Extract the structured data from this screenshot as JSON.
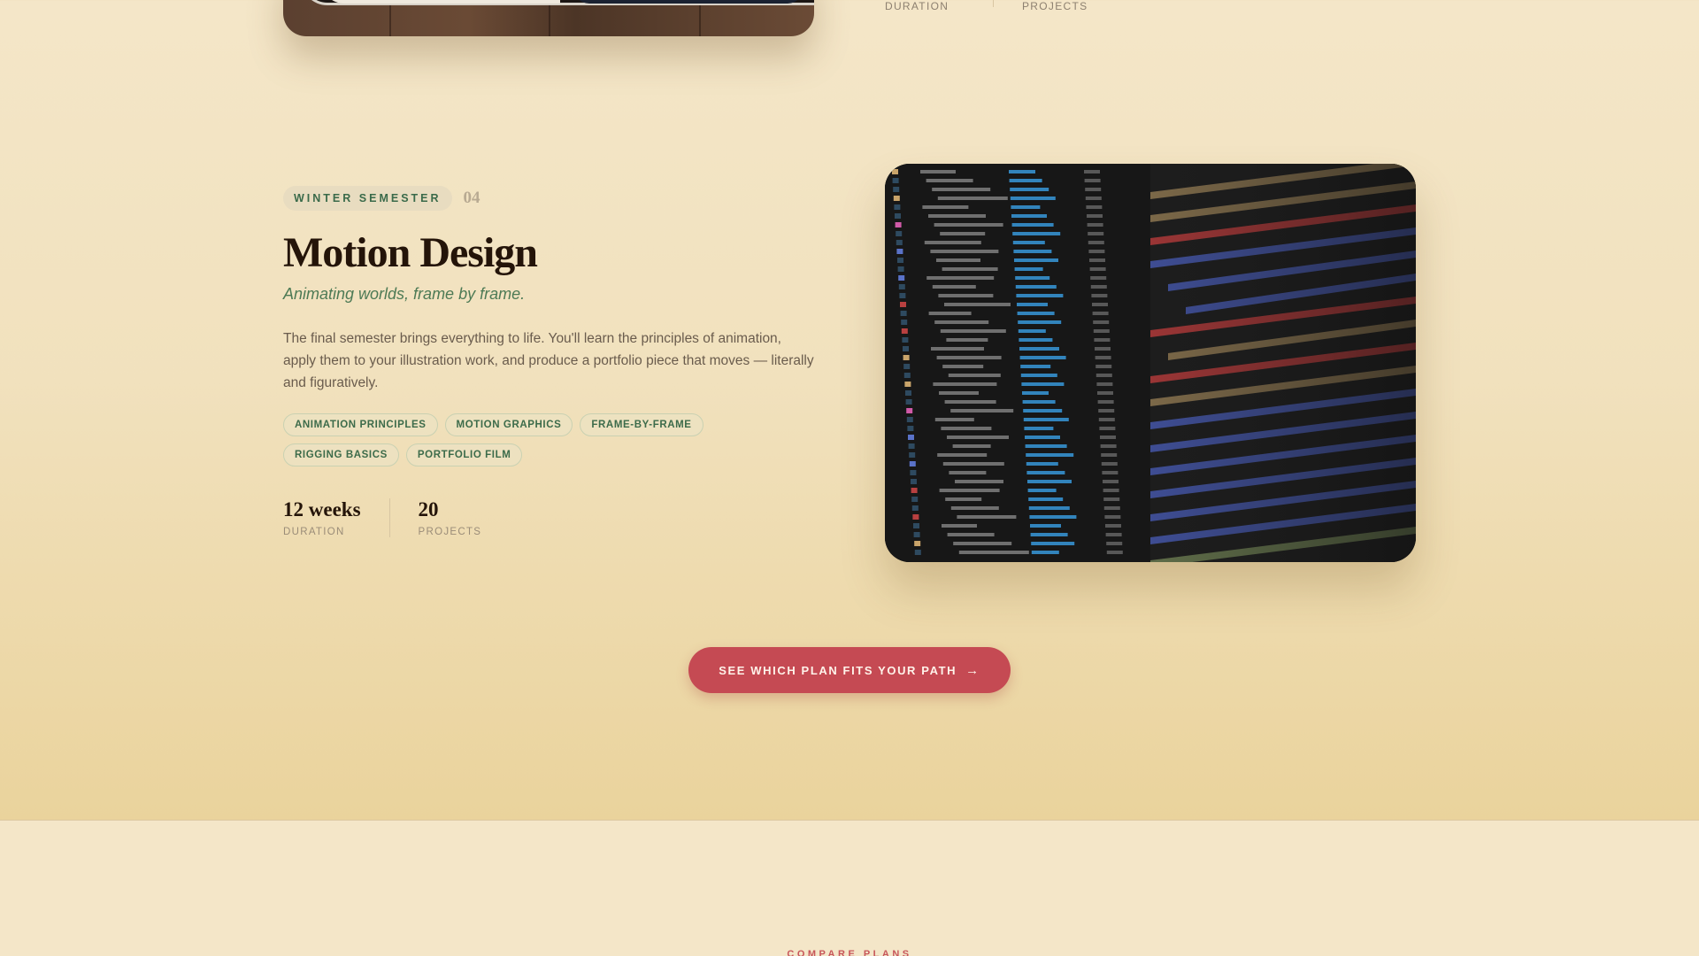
{
  "previous_module": {
    "stats": [
      {
        "label": "DURATION"
      },
      {
        "label": "PROJECTS"
      }
    ]
  },
  "module": {
    "semester": "WINTER SEMESTER",
    "number": "04",
    "title": "Motion Design",
    "tagline": "Animating worlds, frame by frame.",
    "description": "The final semester brings everything to life. You'll learn the principles of animation, apply them to your illustration work, and produce a portfolio piece that moves — literally and figuratively.",
    "tags": [
      "ANIMATION PRINCIPLES",
      "MOTION GRAPHICS",
      "FRAME-BY-FRAME",
      "RIGGING BASICS",
      "PORTFOLIO FILM"
    ],
    "stats": [
      {
        "value": "12 weeks",
        "label": "DURATION"
      },
      {
        "value": "20",
        "label": "PROJECTS"
      }
    ]
  },
  "cta": {
    "label": "SEE WHICH PLAN FITS YOUR PATH",
    "icon": "arrow-right-icon"
  },
  "next_section": {
    "eyebrow": "COMPARE PLANS"
  },
  "colors": {
    "background": "#f4e6c8",
    "badge_text": "#3a6a4a",
    "accent_green": "#4d7a55",
    "cta": "#c54a53",
    "heading": "#241409"
  }
}
